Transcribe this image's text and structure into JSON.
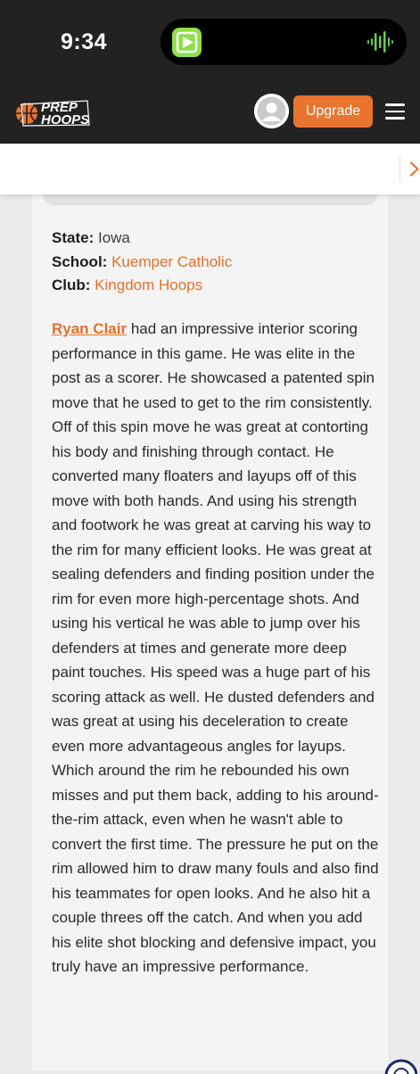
{
  "status_bar": {
    "time": "9:34"
  },
  "header": {
    "logo_text": "PREP HOOPS",
    "upgrade_label": "Upgrade"
  },
  "profile": {
    "state_label": "State:",
    "state_value": "Iowa",
    "school_label": "School:",
    "school_value": "Kuemper Catholic",
    "club_label": "Club:",
    "club_value": "Kingdom Hoops"
  },
  "article": {
    "player_name": "Ryan Clair",
    "body": " had an impressive interior scoring performance in this game. He was elite in the post as a scorer. He showcased a patented spin move that he used to get to the rim consistently. Off of this spin move he was great at contorting his body and finishing through contact. He converted many floaters and layups off of this move with both hands. And using his strength and footwork he was great at carving his way to the rim for many efficient looks. He was great at sealing defenders and finding position under the rim for even more high-percentage shots. And using his vertical he was able to jump over his defenders at times and generate more deep paint touches. His speed was a huge part of his scoring attack as well. He dusted defenders and was great at using his deceleration to create even more advantageous angles for layups. Which around the rim he rebounded his own misses and put them back, adding to his around-the-rim attack, even when he wasn't able to convert the first time. The pressure he put on the rim allowed him to draw many fouls and also find his teammates for open looks. And he also hit a couple threes off the catch. And when you add his elite shot blocking and defensive impact, you truly have an impressive performance."
  },
  "colors": {
    "accent": "#e87430",
    "dark_bar": "#222222",
    "link": "#e2702b"
  },
  "icons": [
    "play-app-icon",
    "audio-wave-icon",
    "prep-hoops-logo",
    "avatar-icon",
    "menu-icon",
    "chevron-right-icon",
    "chat-icon"
  ]
}
